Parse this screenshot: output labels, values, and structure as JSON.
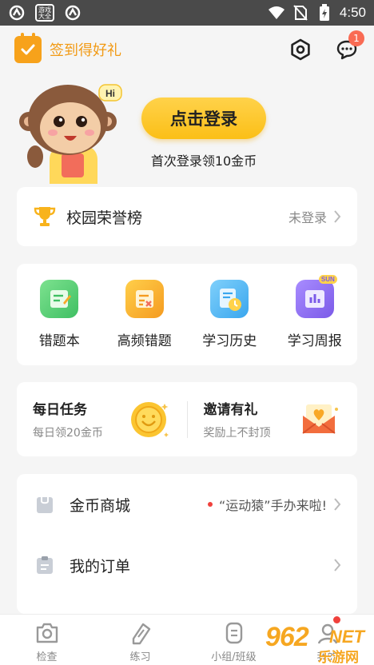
{
  "status_bar": {
    "time": "4:50",
    "badge_text": "游戏大全",
    "icons": [
      "app-s-icon",
      "game-badge-icon",
      "app-s-icon",
      "wifi-icon",
      "no-sim-icon",
      "battery-charging-icon"
    ]
  },
  "header": {
    "signin_label": "签到得好礼",
    "notification_count": "1",
    "icons": [
      "calendar-check-icon",
      "settings-hex-icon",
      "message-icon"
    ]
  },
  "hero": {
    "login_button": "点击登录",
    "login_sub": "首次登录领10金币",
    "mascot_bubble": "Hi"
  },
  "honor": {
    "title": "校园荣誉榜",
    "status": "未登录"
  },
  "tools": [
    {
      "label": "错题本",
      "icon": "wrong-questions-icon",
      "color": "#5fcf7a"
    },
    {
      "label": "高频错题",
      "icon": "frequent-errors-icon",
      "color": "#f8a928"
    },
    {
      "label": "学习历史",
      "icon": "study-history-icon",
      "color": "#4fb7f2"
    },
    {
      "label": "学习周报",
      "icon": "weekly-report-icon",
      "color": "#8b6cf2",
      "tag": "SUN"
    }
  ],
  "tasks": [
    {
      "title": "每日任务",
      "sub": "每日领20金币",
      "icon": "gold-coin-icon"
    },
    {
      "title": "邀请有礼",
      "sub": "奖励上不封顶",
      "icon": "gift-envelope-icon"
    }
  ],
  "menu": [
    {
      "title": "金币商城",
      "note": "“运动猿”手办来啦!",
      "icon": "shop-bag-icon"
    },
    {
      "title": "我的订单",
      "note": "",
      "icon": "clipboard-icon"
    }
  ],
  "tabbar": [
    {
      "label": "检查",
      "icon": "camera-icon"
    },
    {
      "label": "练习",
      "icon": "practice-icon"
    },
    {
      "label": "小组/班级",
      "icon": "group-icon"
    },
    {
      "label": "我的",
      "icon": "profile-icon"
    }
  ],
  "watermark": {
    "number": "962",
    "suffix": "NET",
    "name": "乐游网"
  },
  "colors": {
    "accent_orange": "#f29a14",
    "login_yellow": "#fbbf17",
    "badge_red": "#f96b54",
    "page_bg": "#f5f5f5"
  }
}
